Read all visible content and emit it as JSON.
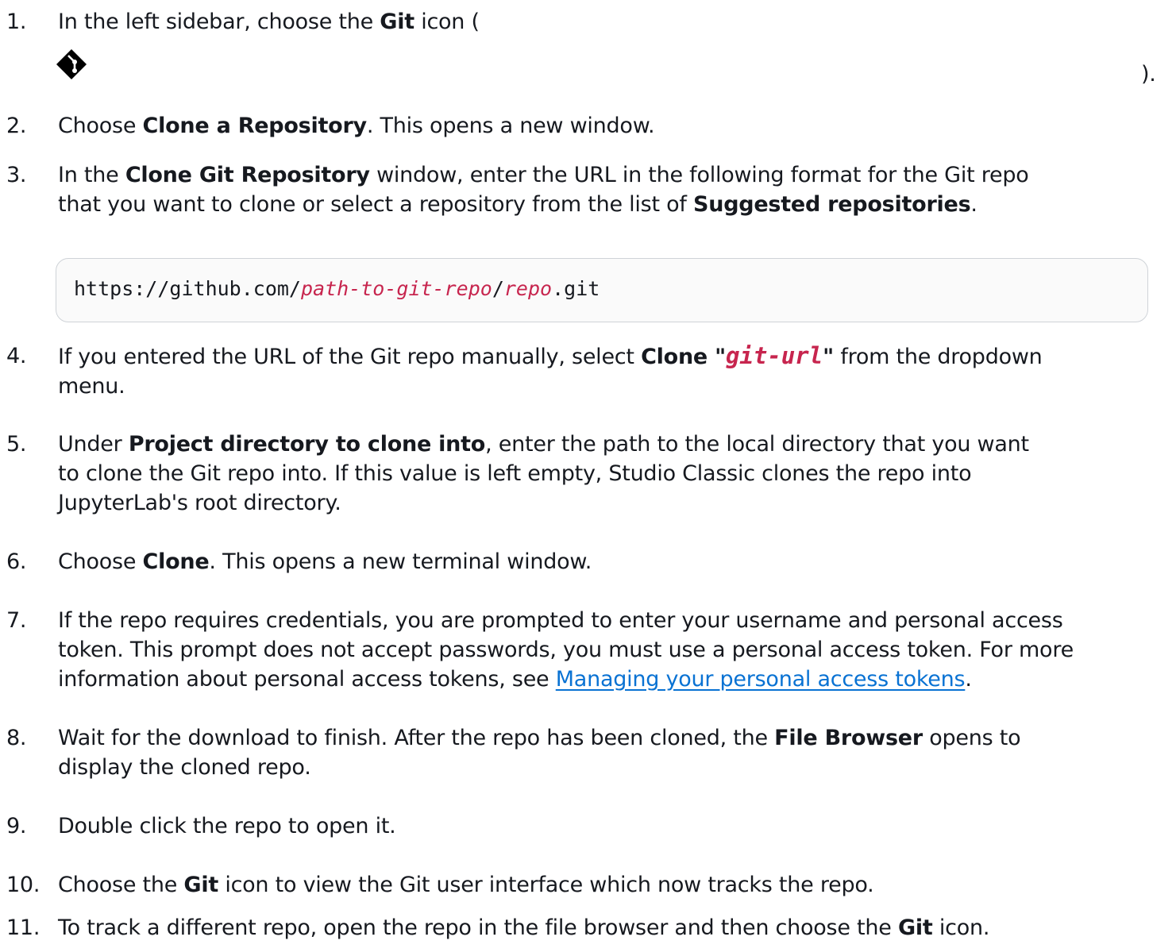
{
  "steps": [
    {
      "num": "1.",
      "a": "In the left sidebar, choose the ",
      "b1": "Git",
      "c": " icon (",
      "close": ")."
    },
    {
      "num": "2.",
      "a": "Choose ",
      "b1": "Clone a Repository",
      "c": ". This opens a new window."
    },
    {
      "num": "3.",
      "a": "In the ",
      "b1": "Clone Git Repository",
      "c": " window, enter the URL in the following format for the Git repo",
      "d": "that you want to clone or select a repository from the list of ",
      "b2": "Suggested repositories",
      "e": "."
    },
    {
      "num": "4.",
      "a": "If you entered the URL of the Git repo manually, select ",
      "b1": "Clone \"",
      "code": "git-url",
      "b2": "\"",
      "c": " from the dropdown",
      "d": "menu."
    },
    {
      "num": "5.",
      "a": "Under ",
      "b1": "Project directory to clone into",
      "c": ", enter the path to the local directory that you want",
      "d": "to clone the Git repo into. If this value is left empty, Studio Classic clones the repo into",
      "e": "JupyterLab's root directory."
    },
    {
      "num": "6.",
      "a": "Choose ",
      "b1": "Clone",
      "c": ". This opens a new terminal window."
    },
    {
      "num": "7.",
      "a": "If the repo requires credentials, you are prompted to enter your username and personal access",
      "d": "token. This prompt does not accept passwords, you must use a personal access token. For more",
      "e": "information about personal access tokens, see ",
      "link": "Managing your personal access tokens",
      "f": "."
    },
    {
      "num": "8.",
      "a": "Wait for the download to finish. After the repo has been cloned, the ",
      "b1": "File Browser",
      "c": " opens to",
      "d": "display the cloned repo."
    },
    {
      "num": "9.",
      "a": "Double click the repo to open it."
    },
    {
      "num": "10.",
      "a": "Choose the ",
      "b1": "Git",
      "c": " icon to view the Git user interface which now tracks the repo."
    },
    {
      "num": "11.",
      "a": "To track a different repo, open the repo in the file browser and then choose the ",
      "b1": "Git",
      "c": " icon."
    }
  ],
  "code_block": {
    "prefix": "https://github.com/",
    "repl1": "path-to-git-repo",
    "slash": "/",
    "repl2": "repo",
    "suffix": ".git"
  },
  "icons": {
    "git": "git-icon"
  }
}
